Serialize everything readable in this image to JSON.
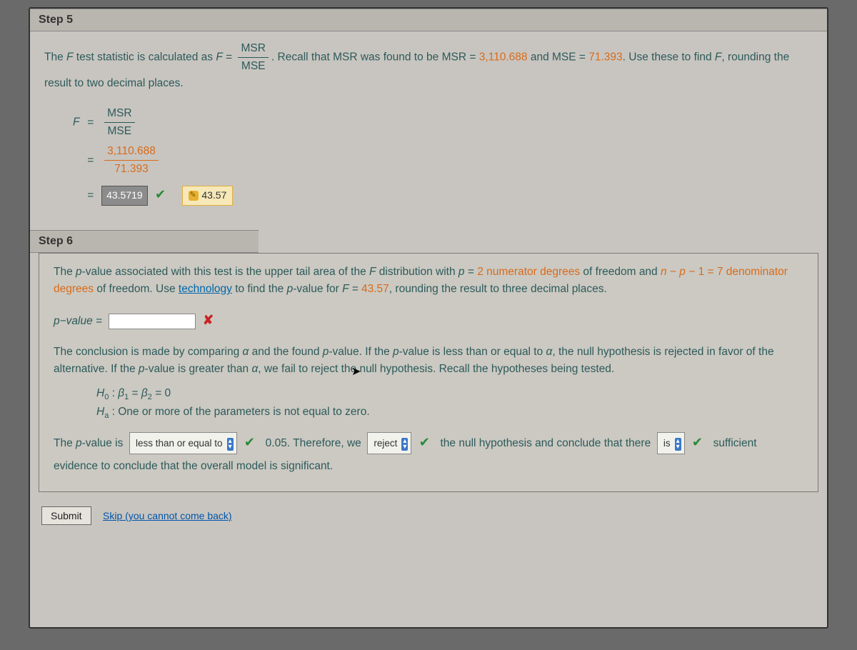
{
  "step5": {
    "label": "Step 5",
    "intro_a": "The ",
    "intro_f": "F",
    "intro_b": " test statistic is calculated as ",
    "intro_c": ". Recall that MSR was found to be MSR = ",
    "msr_val": "3,110.688",
    "intro_d": " and MSE = ",
    "mse_val": "71.393",
    "intro_e": ". Use these to find ",
    "intro_g": ", rounding the result to two decimal places.",
    "frac_num": "MSR",
    "frac_den": "MSE",
    "calc_eq": "F =",
    "calc_num2": "3,110.688",
    "calc_den2": "71.393",
    "answer_full": "43.5719",
    "tip_val": "43.57"
  },
  "step6": {
    "label": "Step 6",
    "p1a": "The ",
    "p1b": "-value associated with this test is the upper tail area of the ",
    "p1c": " distribution with ",
    "p1_p": "p",
    "p1_eq": " = ",
    "num_df": "2 numerator degrees",
    "p1d": " of freedom and ",
    "df_expr": "n − p − 1 = 7 denominator degrees",
    "p1e": " of freedom. Use ",
    "tech": "technology",
    "p1f": " to find the ",
    "p1g": "-value for ",
    "f_eq": "F = ",
    "f_val": "43.57",
    "p1h": ", rounding the result to three decimal places.",
    "pv_label": "p−value =",
    "p2": "The conclusion is made by comparing α and the found p-value. If the p-value is less than or equal to α, the null hypothesis is rejected in favor of the alternative. If the p-value is greater than α, we fail to reject the null hypothesis. Recall the hypotheses being tested.",
    "h0": "H₀ : β₁ = β₂ = 0",
    "ha": "Hₐ : One or more of the parameters is not equal to zero.",
    "c_a": "The ",
    "c_b": "-value is",
    "sel1": "less than or equal to",
    "c_c": "0.05. Therefore, we",
    "sel2": "reject",
    "c_d": "the null hypothesis and conclude that there",
    "sel3": "is",
    "c_e": "sufficient evidence to conclude that the overall model is significant."
  },
  "buttons": {
    "submit": "Submit",
    "skip": "Skip (you cannot come back)"
  }
}
